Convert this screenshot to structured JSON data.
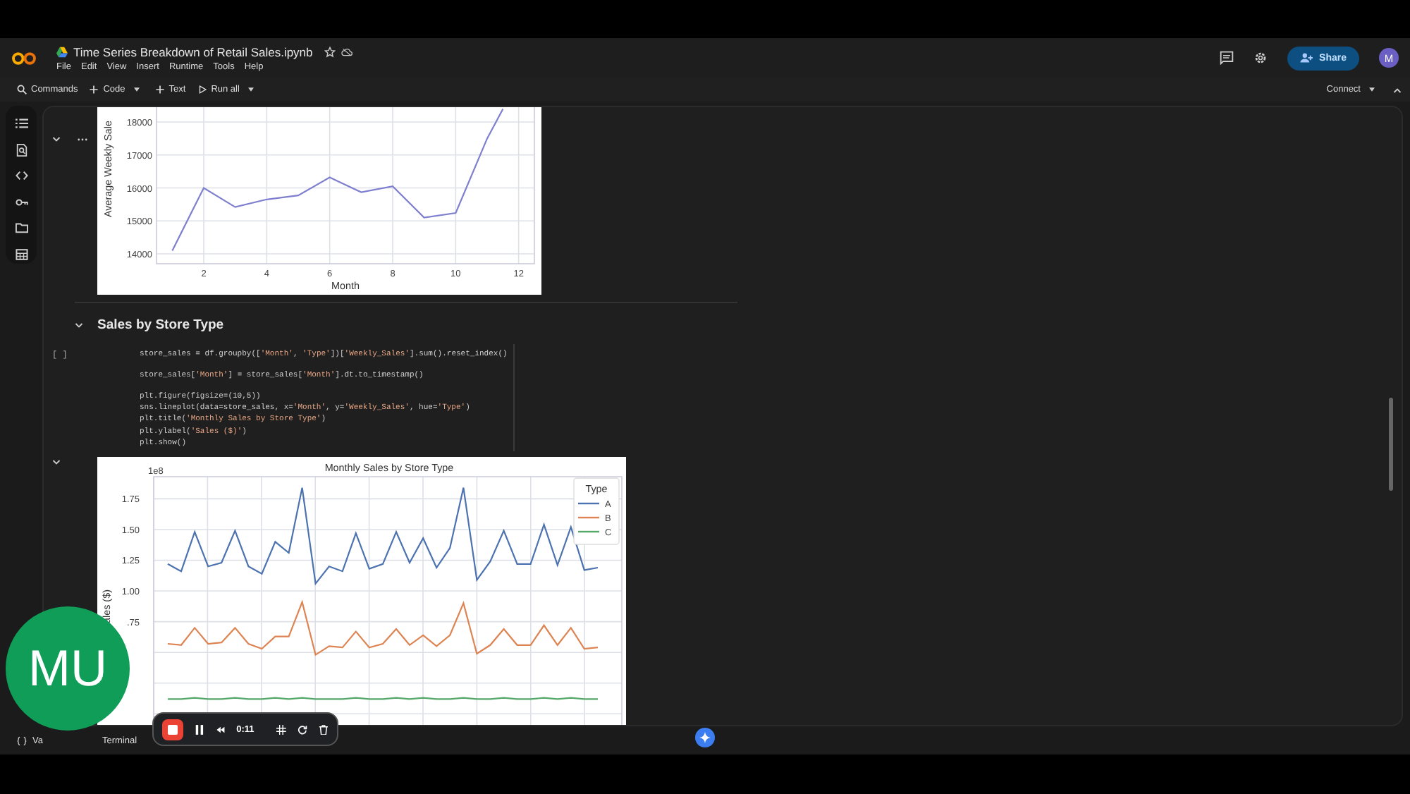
{
  "header": {
    "title": "Time Series Breakdown of Retail Sales.ipynb",
    "menu": [
      "File",
      "Edit",
      "View",
      "Insert",
      "Runtime",
      "Tools",
      "Help"
    ],
    "share": "Share",
    "avatar": "M"
  },
  "toolbar": {
    "items": [
      {
        "kind": "search",
        "label": "Commands"
      },
      {
        "kind": "add-menu",
        "label": "Code"
      },
      {
        "kind": "add",
        "label": "Text"
      },
      {
        "kind": "run-menu",
        "label": "Run all"
      }
    ],
    "connect": "Connect"
  },
  "cells": [
    {
      "kind": "output",
      "chart_data": {
        "type": "line",
        "grid": true,
        "xlabel": "Month",
        "ylabel": "Average Weekly Sale",
        "x": [
          1,
          2,
          3,
          4,
          5,
          6,
          7,
          8,
          9,
          10,
          11,
          11.5
        ],
        "values": [
          14100,
          16000,
          15420,
          15650,
          15770,
          16320,
          15870,
          16050,
          15100,
          15240,
          17500,
          18400
        ],
        "xlim": [
          0.5,
          12.5
        ],
        "ylim": [
          13700,
          18450
        ],
        "xticks": [
          2,
          4,
          6,
          8,
          10,
          12
        ],
        "yticks": [
          14000,
          15000,
          16000,
          17000,
          18000
        ]
      }
    },
    {
      "kind": "heading",
      "text": "Sales by Store Type"
    },
    {
      "kind": "code",
      "prompt": "[ ]",
      "blocks": [
        [
          "store_sales = df.groupby(['Month', 'Type'])['Weekly_Sales'].sum().reset_index()"
        ],
        [
          "store_sales['Month'] = store_sales['Month'].dt.to_timestamp()"
        ],
        [
          "plt.figure(figsize=(10,5))",
          "sns.lineplot(data=store_sales, x='Month', y='Weekly_Sales', hue='Type')",
          "plt.title('Monthly Sales by Store Type')",
          "plt.ylabel('Sales ($)')",
          "plt.show()"
        ]
      ]
    },
    {
      "kind": "output",
      "axis_offset": "1e8",
      "chart_data": {
        "type": "line",
        "grid": true,
        "title": "Monthly Sales by Store Type",
        "ylabel": "ales ($)",
        "legend": {
          "title": "Type"
        },
        "ylim": [
          -0.09,
          1.93
        ],
        "yticks": [
          {
            "value": 1.75,
            "label": "1.75"
          },
          {
            "value": 1.5,
            "label": "1.50"
          },
          {
            "value": 1.25,
            "label": "1.25"
          },
          {
            "value": 1.0,
            "label": "1.00"
          },
          {
            "value": 0.75,
            "label": ".75"
          }
        ],
        "series": [
          {
            "name": "A",
            "color": "#4c72b0",
            "values": [
              1.22,
              1.16,
              1.48,
              1.2,
              1.23,
              1.49,
              1.2,
              1.14,
              1.4,
              1.31,
              1.84,
              1.06,
              1.2,
              1.16,
              1.47,
              1.18,
              1.22,
              1.48,
              1.23,
              1.43,
              1.19,
              1.35,
              1.84,
              1.09,
              1.24,
              1.49,
              1.22,
              1.22,
              1.54,
              1.21,
              1.52,
              1.17,
              1.19
            ]
          },
          {
            "name": "B",
            "color": "#dd8452",
            "values": [
              0.57,
              0.56,
              0.7,
              0.57,
              0.58,
              0.7,
              0.57,
              0.53,
              0.63,
              0.63,
              0.91,
              0.48,
              0.55,
              0.54,
              0.67,
              0.54,
              0.57,
              0.69,
              0.56,
              0.64,
              0.55,
              0.64,
              0.9,
              0.49,
              0.56,
              0.69,
              0.56,
              0.56,
              0.72,
              0.56,
              0.7,
              0.53,
              0.54
            ]
          },
          {
            "name": "C",
            "color": "#55a868",
            "values": [
              0.12,
              0.12,
              0.13,
              0.12,
              0.12,
              0.13,
              0.12,
              0.12,
              0.13,
              0.12,
              0.13,
              0.12,
              0.12,
              0.12,
              0.13,
              0.12,
              0.12,
              0.13,
              0.12,
              0.13,
              0.12,
              0.12,
              0.13,
              0.12,
              0.12,
              0.13,
              0.12,
              0.12,
              0.13,
              0.12,
              0.13,
              0.12,
              0.12
            ]
          }
        ]
      }
    }
  ],
  "status_bar": {
    "items": [
      "Va",
      "Terminal"
    ]
  },
  "recorder": {
    "time": "0:11"
  },
  "webcam": {
    "initials": "MU"
  }
}
